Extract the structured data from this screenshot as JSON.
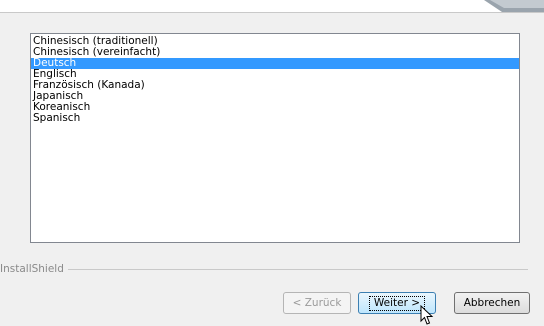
{
  "languages": {
    "items": [
      {
        "label": "Chinesisch (traditionell)",
        "selected": false
      },
      {
        "label": "Chinesisch (vereinfacht)",
        "selected": false
      },
      {
        "label": "Deutsch",
        "selected": true
      },
      {
        "label": "Englisch",
        "selected": false
      },
      {
        "label": "Französisch (Kanada)",
        "selected": false
      },
      {
        "label": "Japanisch",
        "selected": false
      },
      {
        "label": "Koreanisch",
        "selected": false
      },
      {
        "label": "Spanisch",
        "selected": false
      }
    ]
  },
  "footer": {
    "brand": "InstallShield",
    "back_label": "< Zurück",
    "next_label": "Weiter >",
    "cancel_label": "Abbrechen"
  },
  "colors": {
    "selection": "#3399ff",
    "window_bg": "#f0f0f0"
  }
}
